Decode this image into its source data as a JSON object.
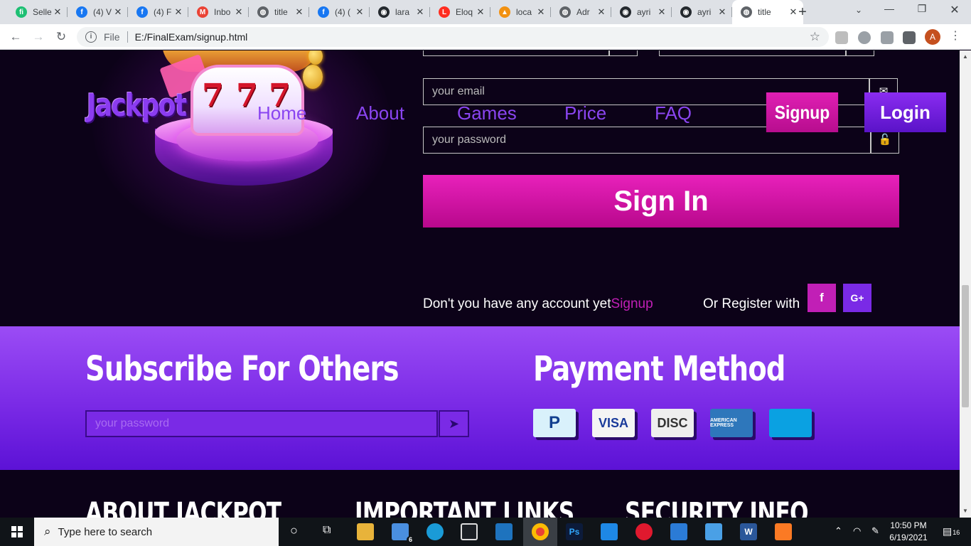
{
  "browser": {
    "tabs": [
      {
        "title": "Selle",
        "icon": "fiverr-icon",
        "color": "#1dbf73",
        "glyph": "fi"
      },
      {
        "title": "(4) V",
        "icon": "facebook-icon",
        "color": "#1877f2",
        "glyph": "f"
      },
      {
        "title": "(4) F",
        "icon": "facebook-icon",
        "color": "#1877f2",
        "glyph": "f"
      },
      {
        "title": "Inbo",
        "icon": "gmail-icon",
        "color": "#ea4335",
        "glyph": "M"
      },
      {
        "title": "title",
        "icon": "globe-icon",
        "color": "#5f6368",
        "glyph": "◍"
      },
      {
        "title": "(4) (",
        "icon": "facebook-icon",
        "color": "#1877f2",
        "glyph": "f"
      },
      {
        "title": "lara",
        "icon": "github-icon",
        "color": "#24292e",
        "glyph": "◉"
      },
      {
        "title": "Eloq",
        "icon": "laravel-icon",
        "color": "#ff2d20",
        "glyph": "L"
      },
      {
        "title": "loca",
        "icon": "phpmyadmin-icon",
        "color": "#f29111",
        "glyph": "▲"
      },
      {
        "title": "Adr",
        "icon": "globe-icon",
        "color": "#5f6368",
        "glyph": "◍"
      },
      {
        "title": "ayri",
        "icon": "github-icon",
        "color": "#24292e",
        "glyph": "◉"
      },
      {
        "title": "ayri",
        "icon": "github-icon",
        "color": "#24292e",
        "glyph": "◉"
      },
      {
        "title": "title",
        "icon": "globe-icon",
        "color": "#5f6368",
        "glyph": "◍",
        "active": true
      }
    ],
    "new_tab": "+",
    "address": {
      "scheme_label": "File",
      "url": "E:/FinalExam/signup.html"
    },
    "profile_initial": "A"
  },
  "site": {
    "logo": "Jackpot",
    "reel_digits": [
      "7",
      "7",
      "7"
    ],
    "nav": [
      "Home",
      "About",
      "Games",
      "Price",
      "FAQ"
    ],
    "signup_button": "Signup",
    "login_button": "Login",
    "form": {
      "email_placeholder": "your email",
      "password_placeholder": "your password",
      "submit": "Sign In"
    },
    "account_prompt": "Don't you have any account yet",
    "account_link": "Signup",
    "register_with": "Or Register with",
    "social": [
      {
        "label": "f",
        "color": "#c11fb6",
        "icon": "facebook-icon"
      },
      {
        "label": "G+",
        "color": "#7a2ae6",
        "icon": "google-plus-icon"
      }
    ],
    "subscribe": {
      "title": "Subscribe For Others",
      "placeholder": "your password"
    },
    "payment": {
      "title": "Payment Method",
      "methods": [
        {
          "label": "P",
          "name": "paypal-icon",
          "bg": "#d9f1fb",
          "fg": "#123f8f"
        },
        {
          "label": "VISA",
          "name": "visa-icon",
          "bg": "#f4f4f4",
          "fg": "#1a3a9a"
        },
        {
          "label": "DISC",
          "name": "discover-icon",
          "bg": "#eeeeee",
          "fg": "#333333"
        },
        {
          "label": "AMERICAN EXPRESS",
          "name": "amex-icon",
          "bg": "#2e77bb",
          "fg": "#ffffff"
        },
        {
          "label": "",
          "name": "mastercard-icon",
          "bg": "#0aa1e2",
          "fg": "#ffffff"
        }
      ]
    },
    "footer_headings": [
      "ABOUT JACKPOT",
      "IMPORTANT LINKS",
      "SECURITY INFO"
    ]
  },
  "taskbar": {
    "search_placeholder": "Type here to search",
    "mail_badge": "6",
    "time": "10:50 PM",
    "date": "6/19/2021",
    "notifications": "16"
  },
  "colors": {
    "page_bg": "#0c0218",
    "accent_pink": "#c11fb6",
    "accent_purple": "#7a2ae6"
  }
}
